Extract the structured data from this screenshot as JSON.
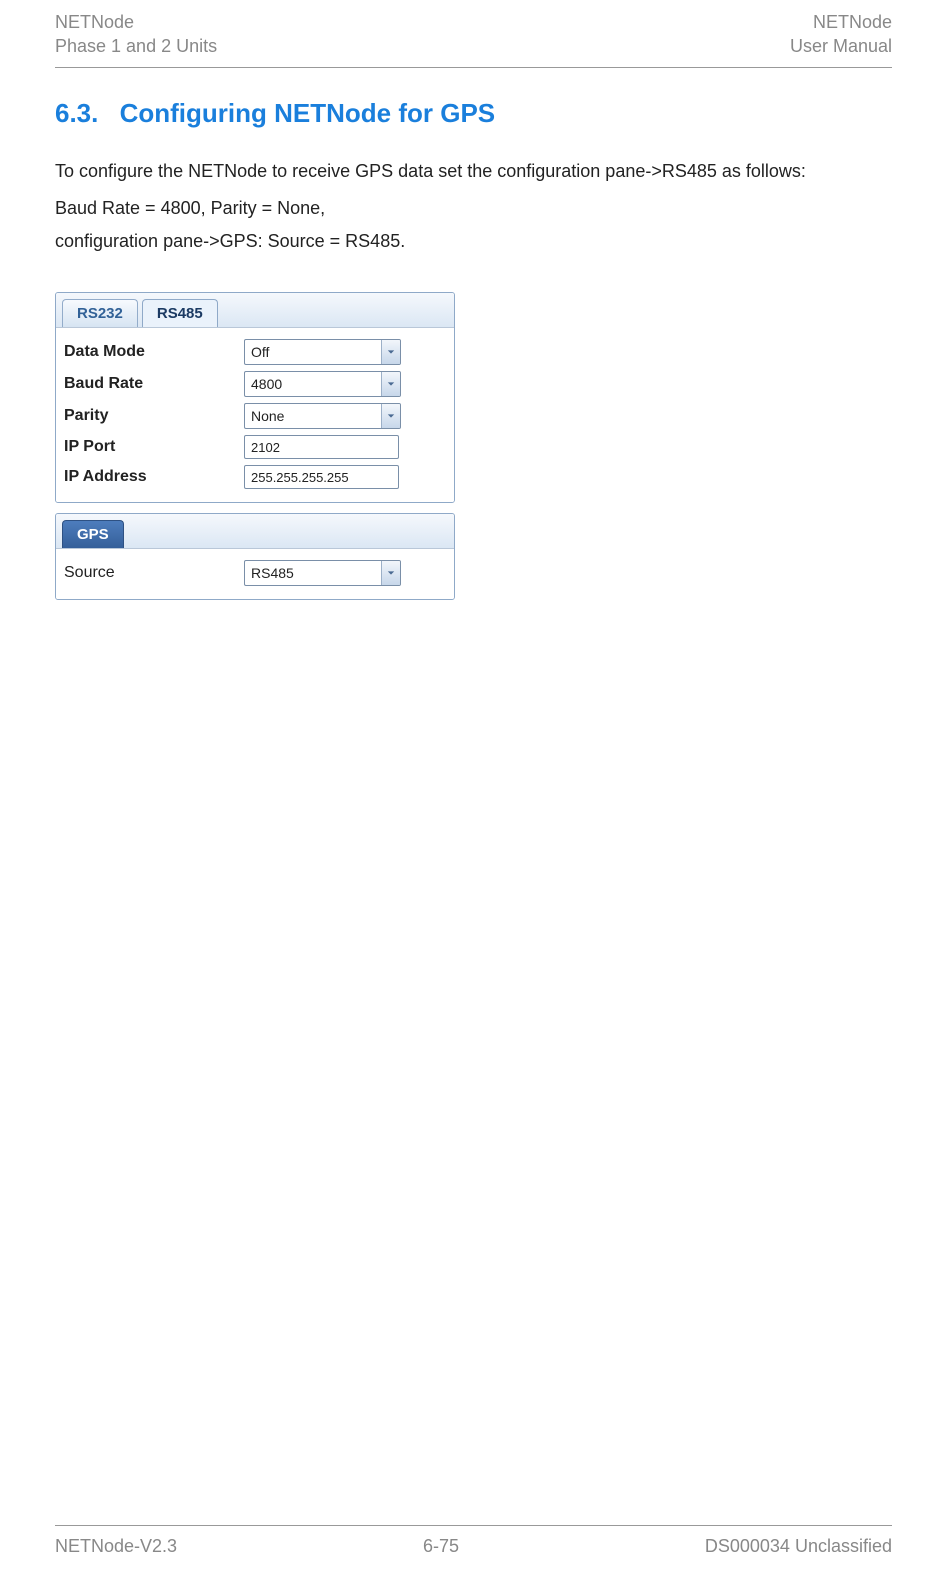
{
  "header": {
    "left_line1": "NETNode",
    "left_line2": "Phase 1 and 2 Units",
    "right_line1": "NETNode",
    "right_line2": "User Manual"
  },
  "section": {
    "number": "6.3.",
    "title": "Configuring NETNode for GPS"
  },
  "paragraphs": {
    "p1": "To configure the NETNode to receive GPS data set the configuration pane->RS485 as follows:",
    "p2": "Baud Rate = 4800, Parity = None,",
    "p3": "configuration pane->GPS: Source = RS485."
  },
  "pane_serial": {
    "tabs": {
      "rs232": "RS232",
      "rs485": "RS485"
    },
    "fields": {
      "data_mode": {
        "label": "Data Mode",
        "value": "Off"
      },
      "baud_rate": {
        "label": "Baud Rate",
        "value": "4800"
      },
      "parity": {
        "label": "Parity",
        "value": "None"
      },
      "ip_port": {
        "label": "IP Port",
        "value": "2102"
      },
      "ip_address": {
        "label": "IP Address",
        "value": "255.255.255.255"
      }
    }
  },
  "pane_gps": {
    "tab": "GPS",
    "fields": {
      "source": {
        "label": "Source",
        "value": "RS485"
      }
    }
  },
  "footer": {
    "left": "NETNode-V2.3",
    "center": "6-75",
    "right": "DS000034 Unclassified"
  }
}
